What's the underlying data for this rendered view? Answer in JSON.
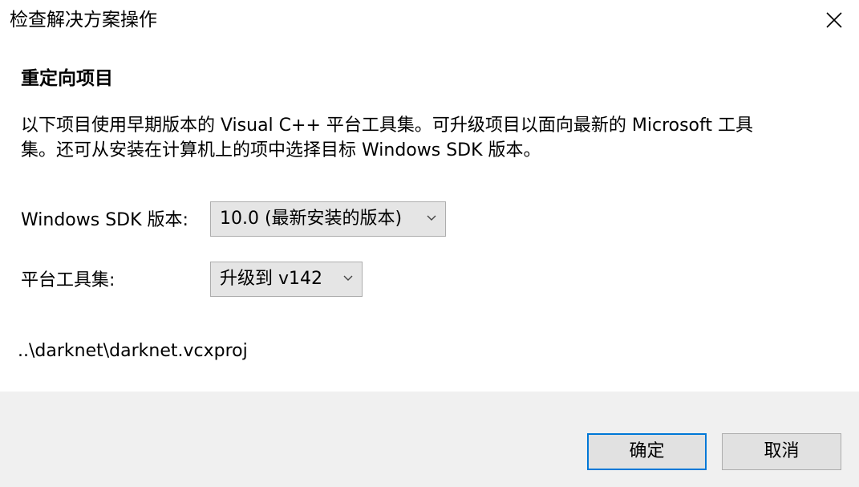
{
  "window": {
    "title": "检查解决方案操作"
  },
  "heading": "重定向项目",
  "description": {
    "line1": "以下项目使用早期版本的 Visual C++ 平台工具集。可升级项目以面向最新的 Microsoft 工具",
    "line2": "集。还可从安装在计算机上的项中选择目标 Windows SDK 版本。"
  },
  "sdk": {
    "label": "Windows SDK 版本:",
    "selected": "10.0 (最新安装的版本)"
  },
  "toolset": {
    "label": "平台工具集:",
    "selected": "升级到 v142"
  },
  "project_path": "..\\darknet\\darknet.vcxproj",
  "buttons": {
    "ok": "确定",
    "cancel": "取消"
  },
  "icons": {
    "close": "close-icon",
    "dropdown": "chevron-down-icon"
  },
  "colors": {
    "accent": "#0078d7",
    "footer_bg": "#f0f0f0",
    "button_bg": "#e1e1e1",
    "select_bg": "#e5e5e5"
  }
}
